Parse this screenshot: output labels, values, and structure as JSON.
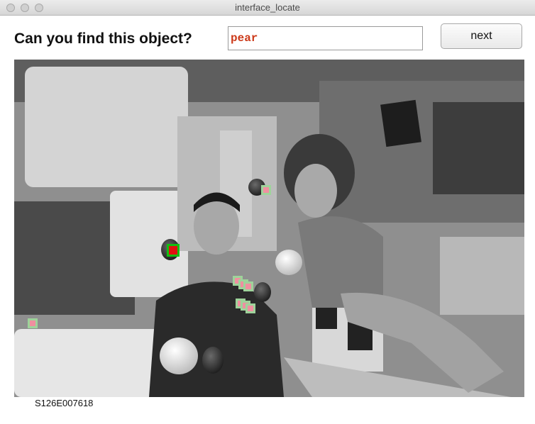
{
  "window": {
    "title": "interface_locate"
  },
  "header": {
    "question": "Can you find this object?",
    "answer_value": "pear",
    "next_label": "next"
  },
  "image": {
    "caption": "S126E007618",
    "description_markers": {
      "candidate_count": 8,
      "selected_count": 1
    }
  },
  "colors": {
    "answer_text": "#cc3a1a",
    "marker_fill": "#f08fa0",
    "marker_border": "#9ed39a",
    "selected_fill": "#e01010",
    "selected_border": "#11c011"
  }
}
